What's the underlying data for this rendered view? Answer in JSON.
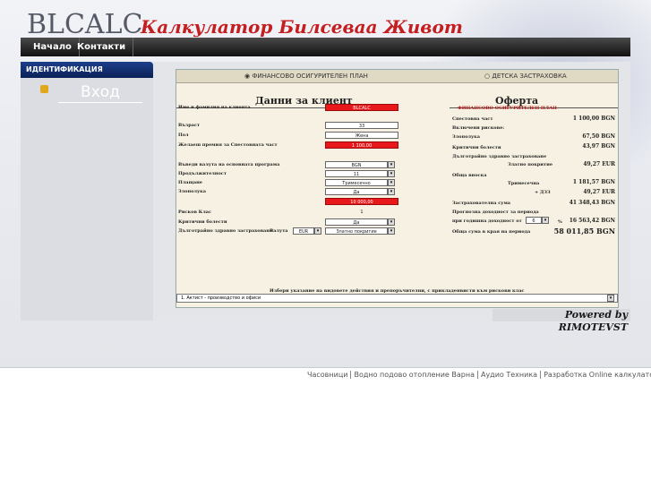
{
  "site": {
    "logo": "BLCALC",
    "tagline": "Калкулатор Билсеваа Живот"
  },
  "nav": [
    {
      "label": "Начало"
    },
    {
      "label": "Контакти"
    }
  ],
  "sidebar": {
    "header": "ИДЕНТИФИКАЦИЯ",
    "login": "Вход"
  },
  "app": {
    "tab1": "ФИНАНСОВО ОСИГУРИТЕЛЕН ПЛАН",
    "tab2": "ДЕТСКА ЗАСТРАХОВКА",
    "left_title": "Данни за клиент",
    "right_title": "Оферта",
    "right_subtitle": "ФИНАНСОВО ОСИГУРИТЕЛЕН ПЛАН",
    "fields": [
      {
        "label": "Име и фамилия на клиента",
        "value": "BLCALC",
        "red": true
      },
      {
        "label": "Възраст",
        "value": "33",
        "red": false
      },
      {
        "label": "Пол",
        "value": "Жена",
        "red": false
      },
      {
        "label": "Желаеш премия за Спестовната част",
        "value": "1 100,00",
        "red": true
      },
      {
        "label": "Въведи валута на основната програма",
        "value": "BGN",
        "red": false
      },
      {
        "label": "Продължителност",
        "value": "11",
        "red": false
      },
      {
        "label": "Плащане",
        "value": "Тримесечно",
        "red": false
      },
      {
        "label": "Злополука",
        "value": "Да",
        "red": false
      },
      {
        "label": "",
        "value": "10 000,00",
        "red": true
      },
      {
        "label": "Рисков Клас",
        "value": "1",
        "red": false
      },
      {
        "label": "Критични болести",
        "value": "Да",
        "red": false
      }
    ],
    "health_label": "Дълготрайно здравно застраховане",
    "currency_label": "Валута",
    "currency_value": "EUR",
    "coverage_value": "Златно покритие",
    "offer": [
      {
        "label": "Спестовна част",
        "value": "1 100,00 BGN"
      },
      {
        "label": "Включени рискове:",
        "value": ""
      },
      {
        "label": "Злополука",
        "value": "67,50 BGN"
      },
      {
        "label": "Критични болести",
        "value": "43,97 BGN"
      },
      {
        "label": "Дълготрайно здравно застраховане",
        "value": ""
      },
      {
        "label": "Златно покритие",
        "value": "49,27 EUR"
      },
      {
        "label": "Обща вноска",
        "value": ""
      },
      {
        "label": "Тримесечна",
        "value": "1 181,57 BGN"
      },
      {
        "label": "+ ДЗЗ",
        "value": "49,27 EUR"
      },
      {
        "label": "Застрахователна сума",
        "value": "41 348,43 BGN"
      },
      {
        "label": "Прогнозна доходност за периода",
        "value": ""
      },
      {
        "label": "при годишна доходност от",
        "value": "16 563,42 BGN"
      },
      {
        "label": "Обща сума в края на периода",
        "value": "58 011,85 BGN"
      }
    ],
    "yield_select": "6",
    "yield_pct": "%",
    "bottom_hint": "Избери указание на видовете действия и препоръчителни, с прикладенвисти към рискови клас",
    "bottom_select": "1. Aктист - производство и офиси"
  },
  "powered": "Powered by RIMOTEVST",
  "footer": [
    {
      "label": "Часовници"
    },
    {
      "label": "Водно подово отопление Варна"
    },
    {
      "label": "Аудио Техника"
    },
    {
      "label": "Разработка Online калкулатор"
    }
  ]
}
